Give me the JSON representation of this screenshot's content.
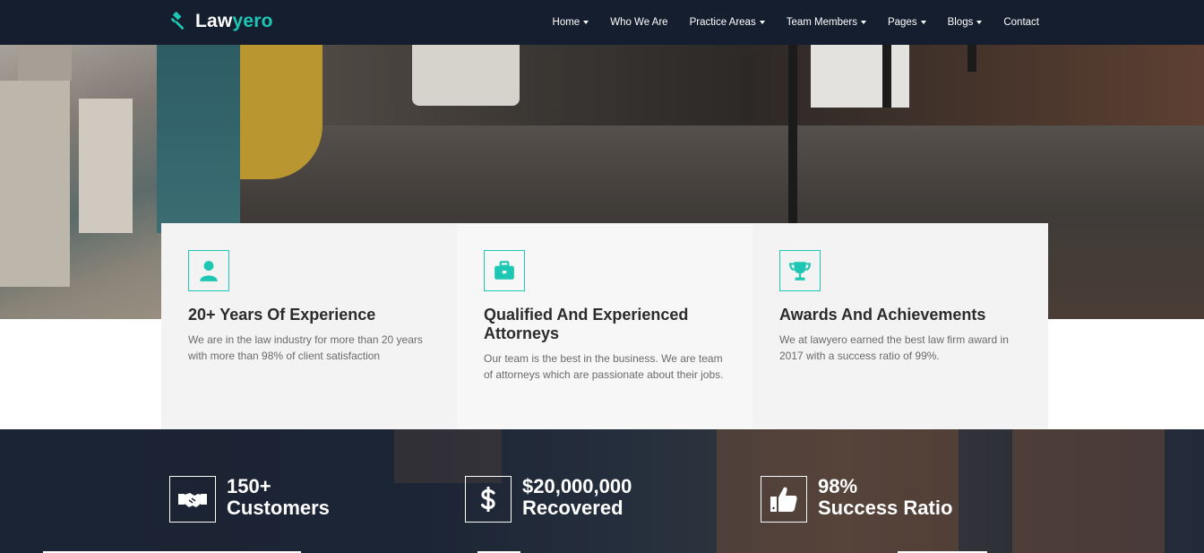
{
  "brand": {
    "part1": "Law",
    "part2": "yero",
    "icon": "gavel-icon",
    "accent": "#1dc7b4"
  },
  "nav": [
    {
      "label": "Home",
      "dropdown": true
    },
    {
      "label": "Who We Are",
      "dropdown": false
    },
    {
      "label": "Practice Areas",
      "dropdown": true
    },
    {
      "label": "Team Members",
      "dropdown": true
    },
    {
      "label": "Pages",
      "dropdown": true
    },
    {
      "label": "Blogs",
      "dropdown": true
    },
    {
      "label": "Contact",
      "dropdown": false
    }
  ],
  "features": [
    {
      "icon": "user-icon",
      "title": "20+ Years Of Experience",
      "text": "We are in the law industry for more than 20 years with more than 98% of client satisfaction"
    },
    {
      "icon": "briefcase-icon",
      "title": "Qualified And Experienced Attorneys",
      "text": "Our team is the best in the business. We are team of attorneys which are passionate about their jobs."
    },
    {
      "icon": "trophy-icon",
      "title": "Awards And Achievements",
      "text": "We at lawyero earned the best law firm award in 2017 with a success ratio of 99%."
    }
  ],
  "stats": [
    {
      "icon": "handshake-icon",
      "number": "150+",
      "label": "Customers"
    },
    {
      "icon": "dollar-icon",
      "number": "$20,000,000",
      "label": "Recovered"
    },
    {
      "icon": "thumbs-up-icon",
      "number": "98%",
      "label": "Success Ratio"
    }
  ],
  "colors": {
    "header_bg": "#141e2e",
    "accent": "#1dc7b4",
    "card_bg": "#f3f3f3",
    "stats_bg": "#1b2434"
  }
}
